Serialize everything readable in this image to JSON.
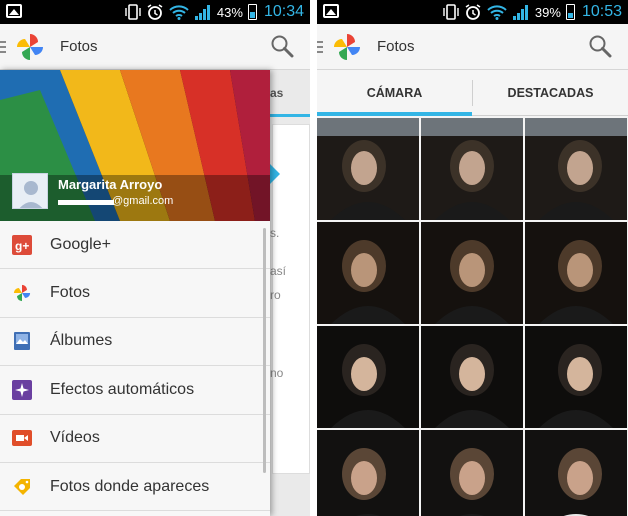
{
  "left": {
    "status": {
      "battery": "43%",
      "time": "10:34",
      "battery_level": 0.43
    },
    "actionbar": {
      "title": "Fotos"
    },
    "drawer": {
      "user_name": "Margarita Arroyo",
      "user_email": "@gmail.com",
      "items": [
        {
          "label": "Google+",
          "icon": "google-plus-icon",
          "color": "#dd4b39"
        },
        {
          "label": "Fotos",
          "icon": "photos-pinwheel-icon",
          "color": "#4285f4"
        },
        {
          "label": "Álbumes",
          "icon": "albums-icon",
          "color": "#3f6fb5"
        },
        {
          "label": "Efectos automáticos",
          "icon": "auto-effects-icon",
          "color": "#6a3fa0"
        },
        {
          "label": "Vídeos",
          "icon": "videos-icon",
          "color": "#e04e2a"
        },
        {
          "label": "Fotos donde apareces",
          "icon": "photos-of-you-tag-icon",
          "color": "#f4b400"
        }
      ]
    },
    "behind_fragments": [
      "as",
      "s.",
      "así",
      "ro",
      "no"
    ]
  },
  "right": {
    "status": {
      "battery": "39%",
      "time": "10:53",
      "battery_level": 0.39
    },
    "actionbar": {
      "title": "Fotos"
    },
    "tabs": [
      {
        "label": "CÁMARA",
        "selected": true
      },
      {
        "label": "DESTACADAS",
        "selected": false
      }
    ]
  },
  "colors": {
    "accent": "#33b5e5",
    "statusbar": "#000000"
  }
}
